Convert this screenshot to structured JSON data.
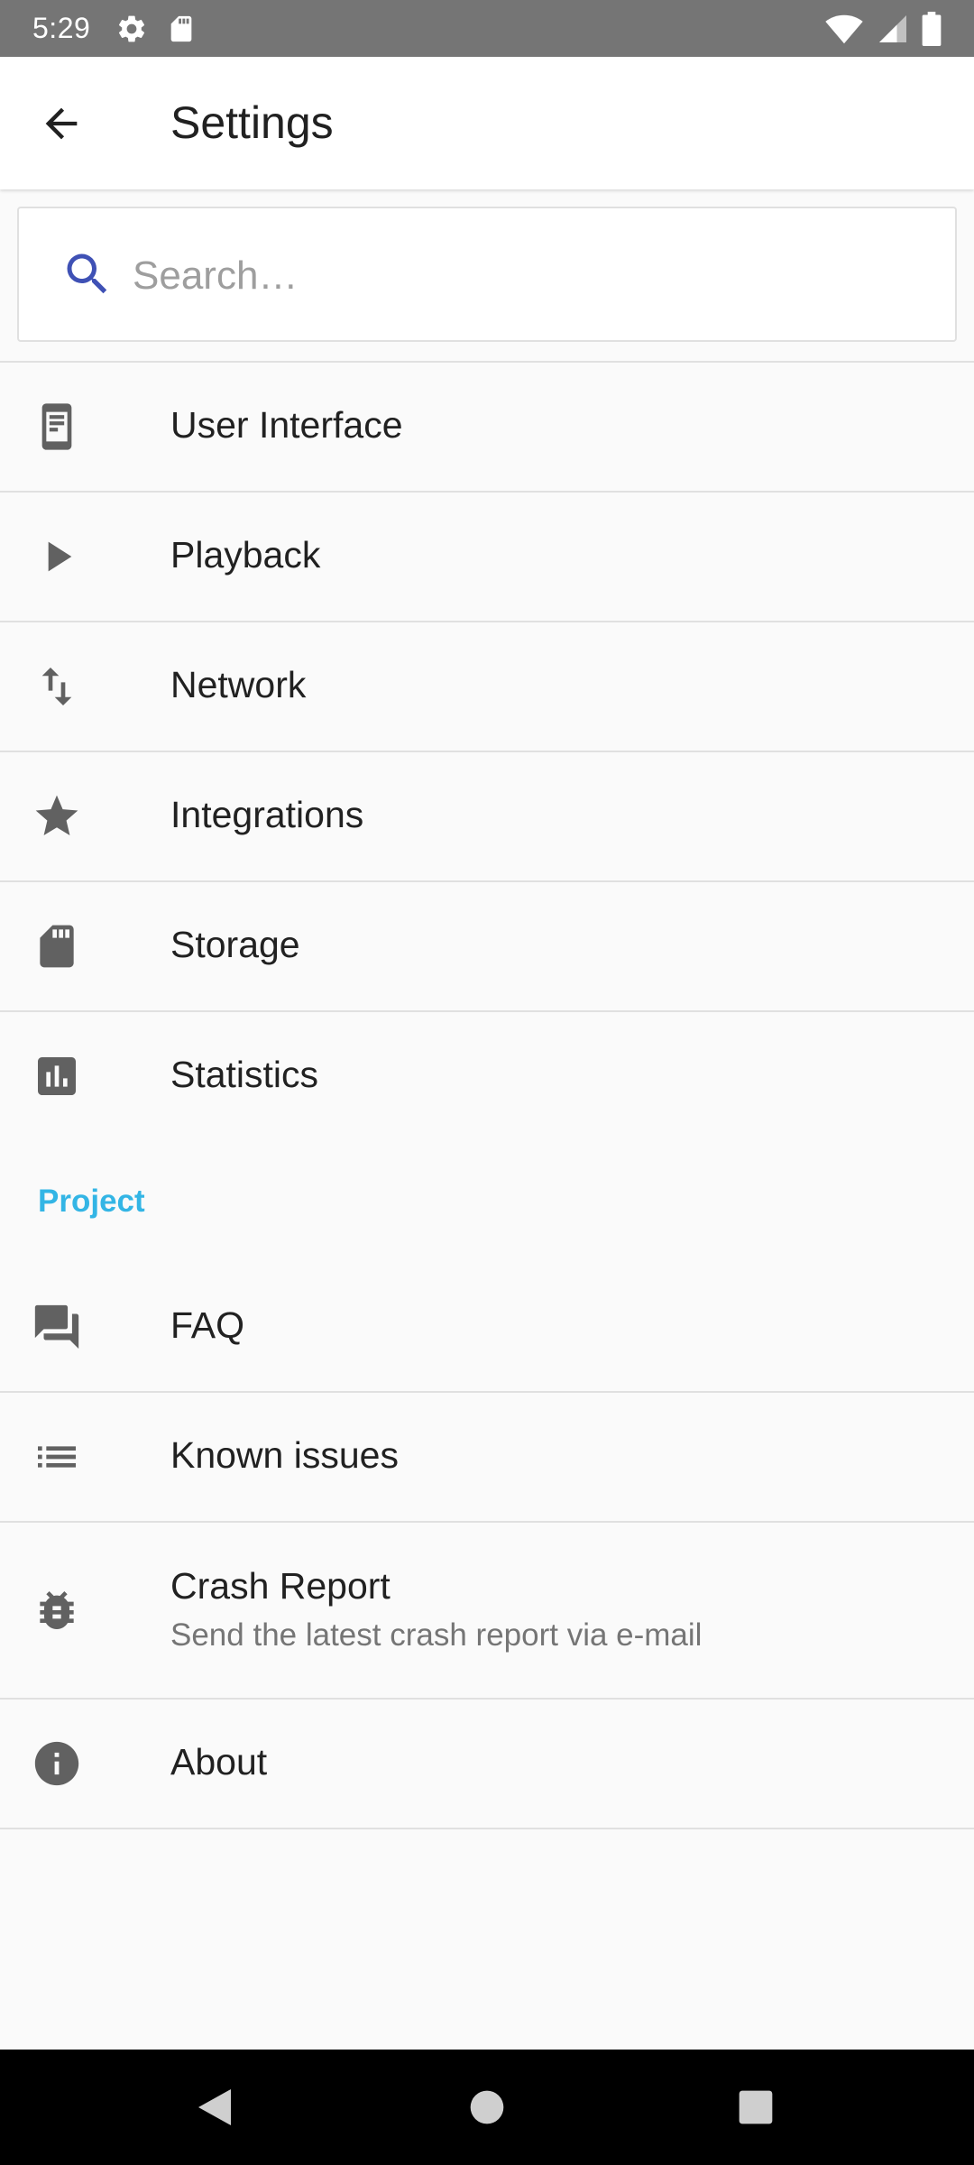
{
  "status_bar": {
    "time": "5:29",
    "icons": [
      "settings-icon",
      "sd-card-icon",
      "wifi-icon",
      "signal-icon",
      "battery-icon"
    ]
  },
  "app_bar": {
    "title": "Settings",
    "back_icon": "arrow-back-icon"
  },
  "search": {
    "placeholder": "Search…",
    "value": "",
    "icon": "search-icon"
  },
  "settings_items": [
    {
      "label": "User Interface",
      "icon": "user-interface-icon"
    },
    {
      "label": "Playback",
      "icon": "play-icon"
    },
    {
      "label": "Network",
      "icon": "swap-vertical-icon"
    },
    {
      "label": "Integrations",
      "icon": "star-icon"
    },
    {
      "label": "Storage",
      "icon": "sd-card-icon"
    },
    {
      "label": "Statistics",
      "icon": "bar-chart-icon"
    }
  ],
  "project_category": {
    "label": "Project",
    "items": [
      {
        "label": "FAQ",
        "icon": "forum-icon"
      },
      {
        "label": "Known issues",
        "icon": "list-icon"
      },
      {
        "label": "Crash Report",
        "summary": "Send the latest crash report via e-mail",
        "icon": "bug-icon"
      },
      {
        "label": "About",
        "icon": "info-icon"
      }
    ]
  },
  "colors": {
    "status_bar": "#757575",
    "accent": "#33b5e5",
    "search_icon": "#3f51b5",
    "icon_gray": "#616161",
    "nav_bar": "#000000"
  },
  "nav_bar": {
    "buttons": [
      "nav-back-icon",
      "nav-home-icon",
      "nav-recents-icon"
    ]
  }
}
